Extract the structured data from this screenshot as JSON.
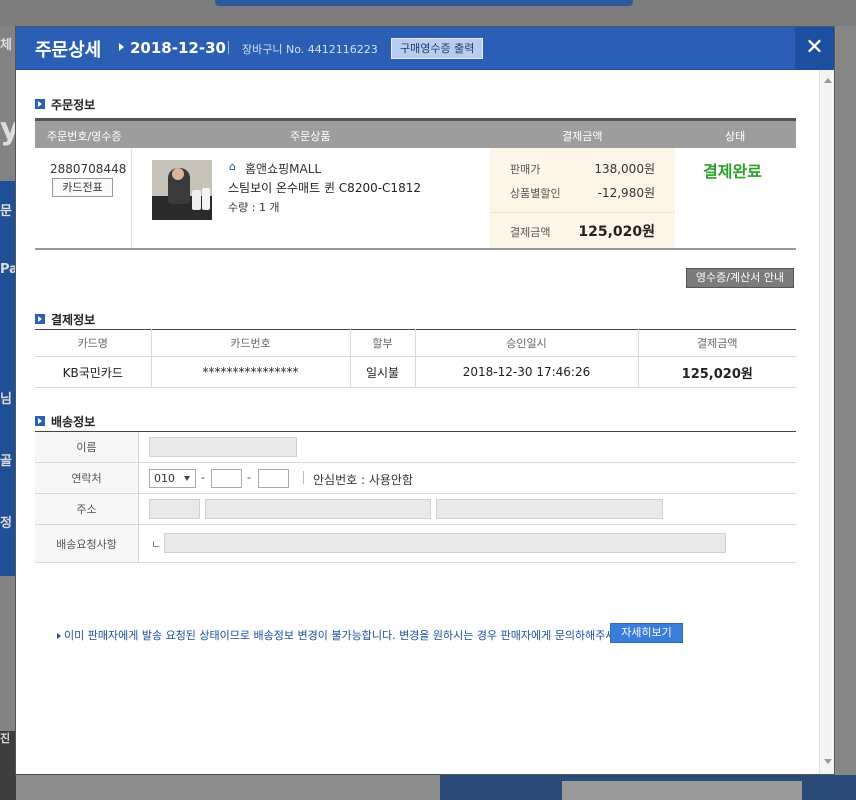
{
  "background": {
    "left_labels": [
      "체",
      "y",
      "문",
      "Pa",
      "님",
      "골",
      "정",
      "진"
    ]
  },
  "header": {
    "title": "주문상세",
    "date": "2018-12-30",
    "cart_label": "장바구니 No. 4412116223",
    "receipt_button": "구매영수증 출력",
    "close_icon": "close-icon"
  },
  "order_info": {
    "section_title": "주문정보",
    "columns": [
      "주문번호/영수증",
      "주문상품",
      "결제금액",
      "상태"
    ],
    "order_no": "2880708448",
    "card_slip_button": "카드전표",
    "shop_name": "홈앤쇼핑MALL",
    "product_name": "스팀보이 온수매트 퀸 C8200-C1812",
    "quantity": "수량 : 1 개",
    "price_label": "판매가",
    "price_value": "138,000원",
    "discount_label": "상품별할인",
    "discount_value": "-12,980원",
    "total_label": "결제금액",
    "total_value": "125,020원",
    "status": "결제완료",
    "receipt_guide_button": "영수증/계산서 안내"
  },
  "payment_info": {
    "section_title": "결제정보",
    "columns": [
      "카드명",
      "카드번호",
      "할부",
      "승인일시",
      "결제금액"
    ],
    "row": {
      "card_name": "KB국민카드",
      "card_number": "****************",
      "installment": "일시불",
      "approved_at": "2018-12-30 17:46:26",
      "amount": "125,020원"
    }
  },
  "delivery_info": {
    "section_title": "배송정보",
    "labels": [
      "이름",
      "연락처",
      "주소",
      "배송요청사항"
    ],
    "phone_prefix": "010",
    "safe_number": "안심번호 : 사용안함",
    "request_mark": "ㄴ",
    "notice": "이미 판매자에게 발송 요청된 상태이므로 배송정보 변경이 불가능합니다. 변경을 원하시는 경우 판매자에게 문의하해주세요.",
    "detail_button": "자세히보기"
  },
  "colors": {
    "header_blue": "#2b5fb5",
    "status_green": "#2aa12a",
    "link_blue": "#1d4fa0"
  }
}
